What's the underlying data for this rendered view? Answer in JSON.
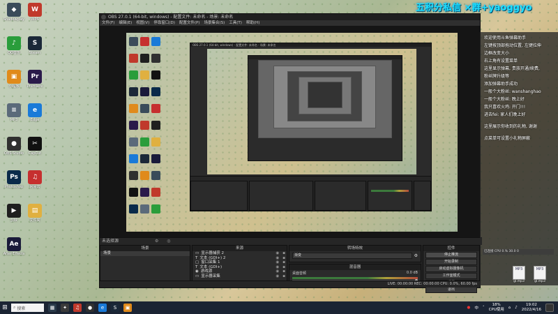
{
  "window": {
    "title": "OBS 27.0.1 (64-bit, windows) - 配置文件: 未命名 - 场景: 未命名"
  },
  "menu": [
    "文件(F)",
    "编辑(E)",
    "视图(V)",
    "停靠窗口(D)",
    "配置文件(P)",
    "场景集合(S)",
    "工具(T)",
    "帮助(H)"
  ],
  "preview": {
    "nested_title": "OBS 27.0.1 (64-bit, windows) - 配置文件: 未命名 - 场景: 未命名"
  },
  "scene_label": "未选择源",
  "docks": {
    "scenes": {
      "title": "场景",
      "items": [
        "场景"
      ]
    },
    "sources": {
      "title": "来源",
      "items": [
        {
          "icon": "display-icon",
          "label": "显示器捕获 2",
          "glyph": "▭"
        },
        {
          "icon": "text-icon",
          "label": "文本 (GDI+) 2",
          "glyph": "T"
        },
        {
          "icon": "window-icon",
          "label": "窗口采集 1",
          "glyph": "▢"
        },
        {
          "icon": "text-icon",
          "label": "文本 (GDI+)",
          "glyph": "T"
        },
        {
          "icon": "eye-icon",
          "label": "游戏源",
          "glyph": "◉"
        },
        {
          "icon": "display-icon",
          "label": "显示器采集",
          "glyph": "▭"
        }
      ]
    },
    "transitions": {
      "title": "转场特效",
      "selected": "渐变",
      "gear": "⚙"
    },
    "mixer": {
      "title": "混音器",
      "track": "桌面音频",
      "db": "0.0 dB"
    },
    "controls": {
      "title": "控件",
      "buttons": [
        "停止推流",
        "开始录制",
        "启动虚拟摄像机",
        "工作室模式",
        "设置",
        "退出"
      ]
    }
  },
  "statusbar": "LIVE: 00:00:00   REC: 00:00:00   CPU: 0.0%, 60.00 fps",
  "overlay": {
    "marquee": "五积分私信 ×群+yaoggyo",
    "chat": [
      "欢迎使用斗鱼弹幕助手",
      "左键按顶部拖动位置, 左键拉伸",
      "边框改变大小",
      "右上角有设置菜单",
      "这里显示弹幕, 贵族开通/续费,",
      "粉丝牌升级等",
      "添加弹幕助手成功",
      "一般个大粉丝: wanshanghao",
      "一般个大粉丝: 晚上好",
      "我只喜欢火鸡: 开门!!!",
      "进去fei: 家人们晚上好",
      "这里展示你收到的礼物, 谢谢",
      "点菜单可设置小礼物屏蔽"
    ],
    "chat_tip": "已连接 CPU 0.%  30.0  0",
    "mp3_files": [
      {
        "name": "MP3",
        "label": "gl.mp3"
      },
      {
        "name": "MP3",
        "label": "gl.mp3"
      }
    ]
  },
  "desktop_icons": [
    {
      "label": "Shadowplay",
      "color": "#3a4b5a",
      "glyph": "◆"
    },
    {
      "label": "WPS",
      "color": "#c0392b",
      "glyph": "W"
    },
    {
      "label": "QQ音乐",
      "color": "#2a9d3b",
      "glyph": "♪"
    },
    {
      "label": "Steam",
      "color": "#1b2838",
      "glyph": "S"
    },
    {
      "label": "小程序",
      "color": "#e08a1b",
      "glyph": "▣"
    },
    {
      "label": "Premiere",
      "color": "#2a1a4a",
      "glyph": "Pr"
    },
    {
      "label": "MP3",
      "color": "#5b6a7a",
      "glyph": "≡"
    },
    {
      "label": "Edge",
      "color": "#1a7ad8",
      "glyph": "e"
    },
    {
      "label": "OBS Studio",
      "color": "#303030",
      "glyph": "●"
    },
    {
      "label": "CapCut",
      "color": "#111111",
      "glyph": "✂"
    },
    {
      "label": "Photoshop",
      "color": "#0a2a4a",
      "glyph": "Ps"
    },
    {
      "label": "网易云",
      "color": "#c62f2f",
      "glyph": "♫"
    },
    {
      "label": "剪映",
      "color": "#1f1f1f",
      "glyph": "▶"
    },
    {
      "label": "文件夹",
      "color": "#e0b040",
      "glyph": "▤"
    },
    {
      "label": "After Effects",
      "color": "#1a1a3a",
      "glyph": "Ae"
    }
  ],
  "taskbar": {
    "search_placeholder": "搜索",
    "tray_temp": "18%",
    "tray_cpu": "CPU使用",
    "ime": "中",
    "time": "19:02",
    "date": "2022/4/16"
  }
}
